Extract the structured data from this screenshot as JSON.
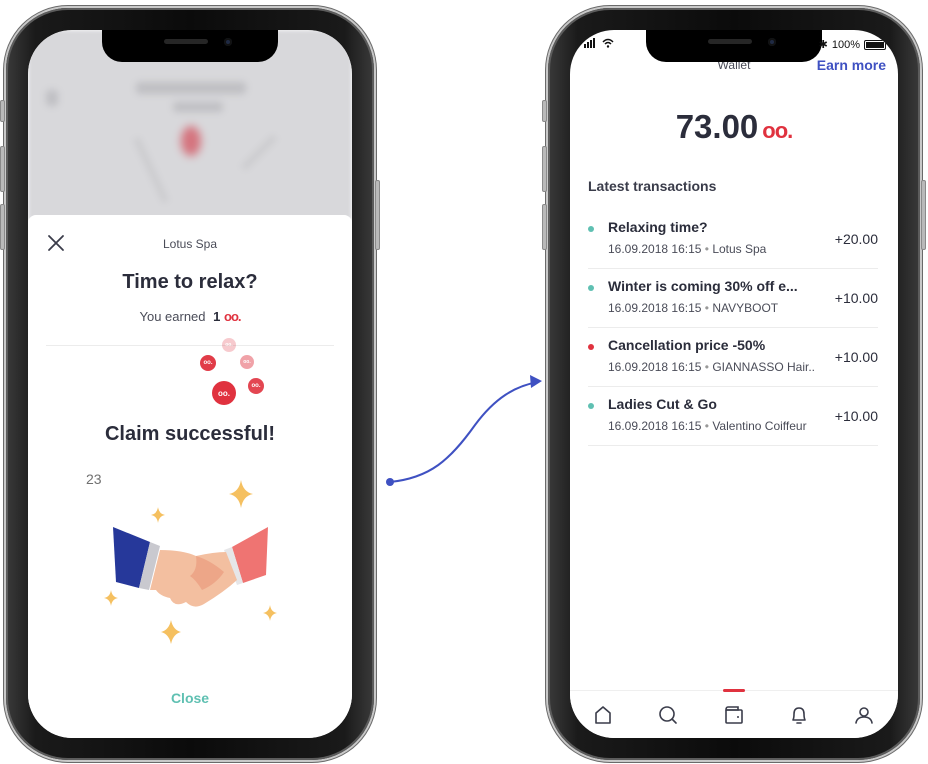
{
  "left_screen": {
    "vendor": "Lotus Spa",
    "title": "Time to relax?",
    "earned_prefix": "You earned",
    "earned_amount": "1",
    "coin_symbol": "oo.",
    "claim_title": "Claim successful!",
    "counter": "23",
    "close_label": "Close",
    "colors": {
      "accent_red": "#e0323f",
      "close_teal": "#5fc0b2"
    }
  },
  "right_screen": {
    "status": {
      "battery": "100%"
    },
    "header": {
      "title": "Wallet",
      "action_label": "Earn more"
    },
    "balance": {
      "amount": "73.00",
      "coin_symbol": "oo."
    },
    "section_title": "Latest transactions",
    "transactions": [
      {
        "title": "Relaxing time?",
        "date": "16.09.2018 16:15",
        "vendor": "Lotus Spa",
        "amount": "+20.00",
        "status": "green"
      },
      {
        "title": "Winter is coming 30% off e...",
        "date": "16.09.2018 16:15",
        "vendor": "NAVYBOOT",
        "amount": "+10.00",
        "status": "green"
      },
      {
        "title": "Cancellation price -50%",
        "date": "16.09.2018 16:15",
        "vendor": "GIANNASSO Hair..",
        "amount": "+10.00",
        "status": "red"
      },
      {
        "title": "Ladies Cut & Go",
        "date": "16.09.2018 16:15",
        "vendor": "Valentino Coiffeur",
        "amount": "+10.00",
        "status": "green"
      }
    ],
    "tabs": [
      {
        "name": "home",
        "icon": "home-icon"
      },
      {
        "name": "search",
        "icon": "search-icon"
      },
      {
        "name": "wallet",
        "icon": "wallet-icon",
        "active": true
      },
      {
        "name": "notifications",
        "icon": "bell-icon"
      },
      {
        "name": "profile",
        "icon": "user-icon"
      }
    ],
    "colors": {
      "accent_blue": "#3f51c2",
      "status_green": "#5fc0b2",
      "status_red": "#e0323f"
    }
  },
  "meta_separator": "•"
}
